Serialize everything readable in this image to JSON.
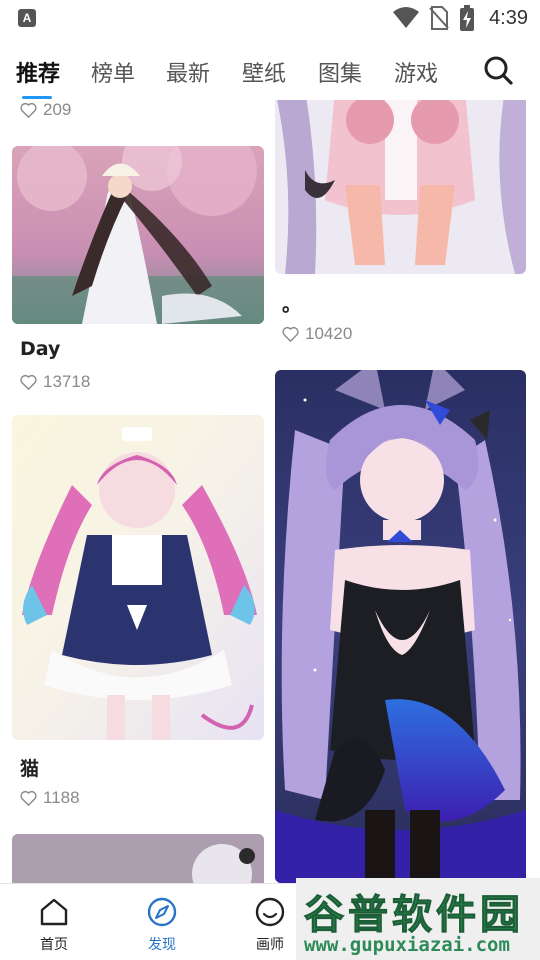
{
  "status_bar": {
    "app_badge": "A",
    "time": "4:39",
    "icons": [
      "wifi-icon",
      "no-sim-icon",
      "battery-charging-icon"
    ]
  },
  "tabs": [
    {
      "label": "推荐",
      "active": true
    },
    {
      "label": "榜单",
      "active": false
    },
    {
      "label": "最新",
      "active": false
    },
    {
      "label": "壁纸",
      "active": false
    },
    {
      "label": "图集",
      "active": false
    },
    {
      "label": "游戏",
      "active": false
    }
  ],
  "search_icon": "search-icon",
  "feed": {
    "left": [
      {
        "title": "",
        "likes": "209"
      },
      {
        "title": "Day",
        "likes": "13718"
      },
      {
        "title": "猫",
        "likes": "1188"
      },
      {
        "title": "",
        "likes": ""
      }
    ],
    "right": [
      {
        "title": "。",
        "likes": "10420"
      },
      {
        "title": "",
        "likes": ""
      }
    ]
  },
  "bottom_nav": [
    {
      "label": "首页",
      "icon": "home-icon",
      "active": false
    },
    {
      "label": "发现",
      "icon": "compass-icon",
      "active": true
    },
    {
      "label": "画师",
      "icon": "smiley-icon",
      "active": false
    }
  ],
  "watermark": {
    "main": "谷普软件园",
    "url": "www.gupuxiazai.com"
  },
  "colors": {
    "accent": "#2196f3",
    "active_nav": "#2a73c8",
    "like_gray": "#8a8a8a"
  }
}
